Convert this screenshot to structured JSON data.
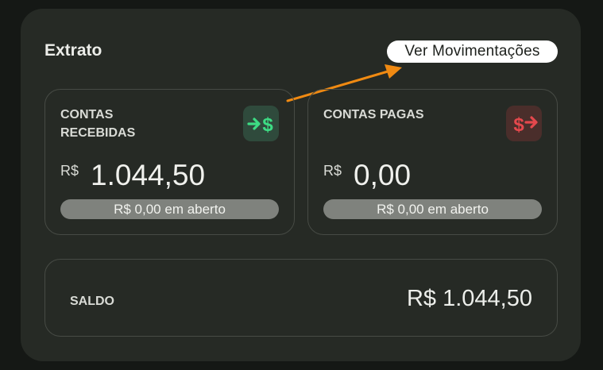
{
  "extrato": {
    "title": "Extrato",
    "ver_movimentacoes_label": "Ver Movimentações"
  },
  "cards": [
    {
      "title": "CONTAS RECEBIDAS",
      "currency": "R$",
      "value": "1.044,50",
      "open_amount": "R$ 0,00 em aberto",
      "icon": "money-in-icon",
      "accent": "#3ddc84",
      "icon_bg": "#2f4a3c"
    },
    {
      "title": "CONTAS PAGAS",
      "currency": "R$",
      "value": "0,00",
      "open_amount": "R$ 0,00 em aberto",
      "icon": "money-out-icon",
      "accent": "#e5484d",
      "icon_bg": "#4a2e2b"
    }
  ],
  "saldo": {
    "label": "SALDO",
    "value": "R$ 1.044,50"
  },
  "colors": {
    "background": "#151815",
    "panel": "#262a25",
    "border": "#474b45",
    "pill": "#7f827d",
    "annotation_arrow": "#f08a12"
  }
}
